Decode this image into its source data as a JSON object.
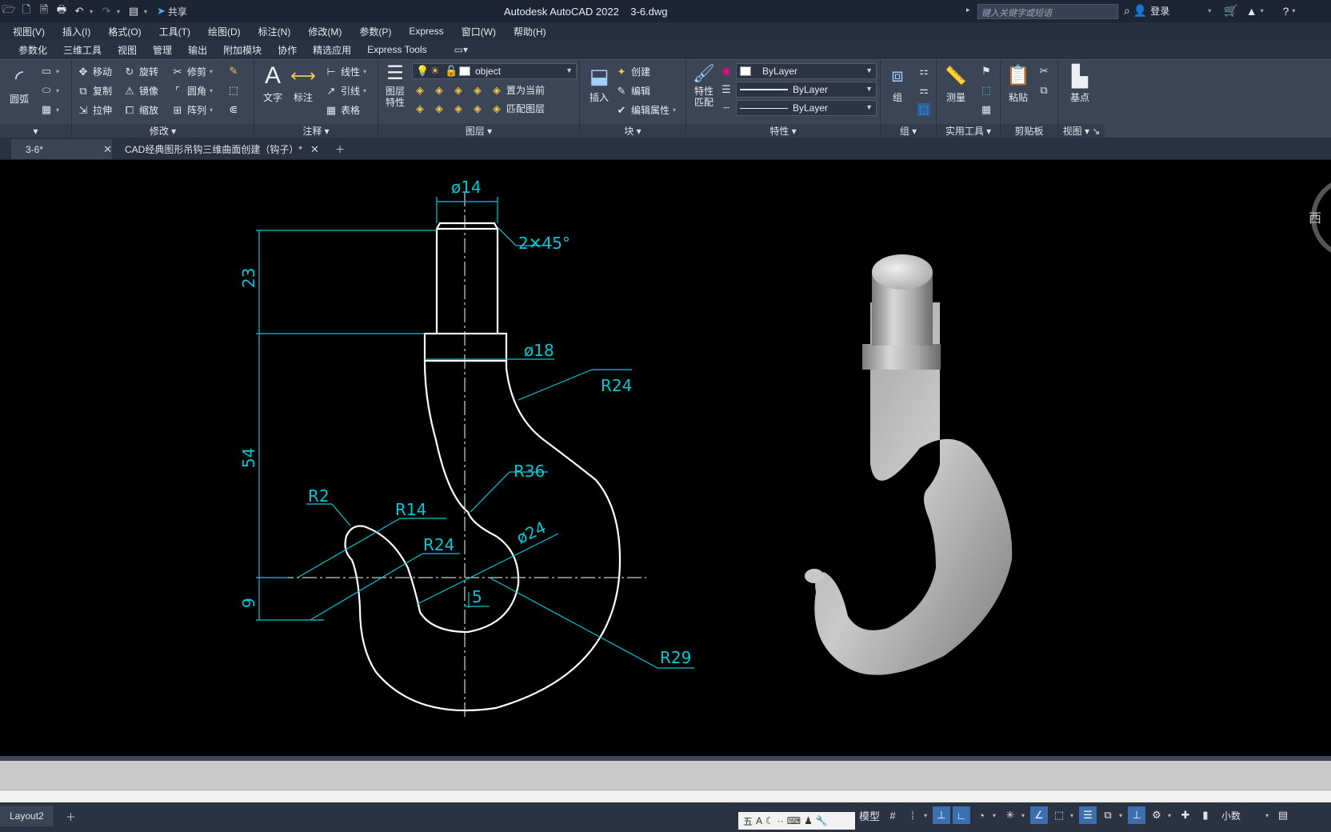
{
  "title_bar": {
    "share": "共享",
    "app_title": "Autodesk AutoCAD 2022    3-6.dwg",
    "search_placeholder": "键入关键字或短语",
    "login": "登录"
  },
  "menu": [
    "视图(V)",
    "插入(I)",
    "格式(O)",
    "工具(T)",
    "绘图(D)",
    "标注(N)",
    "修改(M)",
    "参数(P)",
    "Express",
    "窗口(W)",
    "帮助(H)"
  ],
  "ribbon_tabs": [
    "参数化",
    "三维工具",
    "视图",
    "管理",
    "输出",
    "附加模块",
    "协作",
    "精选应用",
    "Express Tools"
  ],
  "ribbon": {
    "arc": "圆弧",
    "modify": {
      "title": "修改",
      "move": "移动",
      "rotate": "旋转",
      "trim": "修剪",
      "copy": "复制",
      "mirror": "镜像",
      "fillet": "圆角",
      "stretch": "拉伸",
      "scale": "缩放",
      "array": "阵列"
    },
    "annotation": {
      "title": "注释",
      "text": "文字",
      "dimension": "标注",
      "linear": "线性",
      "leader": "引线",
      "table": "表格"
    },
    "layers": {
      "title": "图层",
      "layer_props_1": "图层",
      "layer_props_2": "特性",
      "current_layer": "object",
      "set_current": "置为当前",
      "match_layer": "匹配图层"
    },
    "block": {
      "title": "块",
      "insert": "插入",
      "create": "创建",
      "edit": "编辑",
      "edit_attr": "编辑属性"
    },
    "properties": {
      "title": "特性",
      "match_1": "特性",
      "match_2": "匹配",
      "color": "ByLayer",
      "linetype": "ByLayer",
      "lineweight": "ByLayer"
    },
    "groups": {
      "title": "组",
      "group": "组"
    },
    "utilities": {
      "title": "实用工具",
      "measure": "测量"
    },
    "clipboard": {
      "title": "剪贴板",
      "paste": "粘贴"
    },
    "view": {
      "title": "视图",
      "base": "基点"
    }
  },
  "doc_tabs": [
    {
      "label": "3-6*",
      "active": true
    },
    {
      "label": "CAD经典图形吊钩三维曲面创建（钩子）*",
      "active": false
    }
  ],
  "drawing": {
    "dims": {
      "d14": "ø14",
      "chamfer": "2✕45°",
      "d18": "ø18",
      "r24_top": "R24",
      "v23": "23",
      "v54": "54",
      "v9": "9",
      "r36": "R36",
      "r2": "R2",
      "r14": "R14",
      "r24_mid": "R24",
      "d24": "ø24",
      "h5": "5",
      "r29": "R29"
    },
    "viewcube_label": "西"
  },
  "status": {
    "layout_tab": "Layout2",
    "model": "模型",
    "units": "小数"
  },
  "colors": {
    "dimension": "#00c8d7",
    "geometry": "#ffffff",
    "canvas": "#000000"
  }
}
